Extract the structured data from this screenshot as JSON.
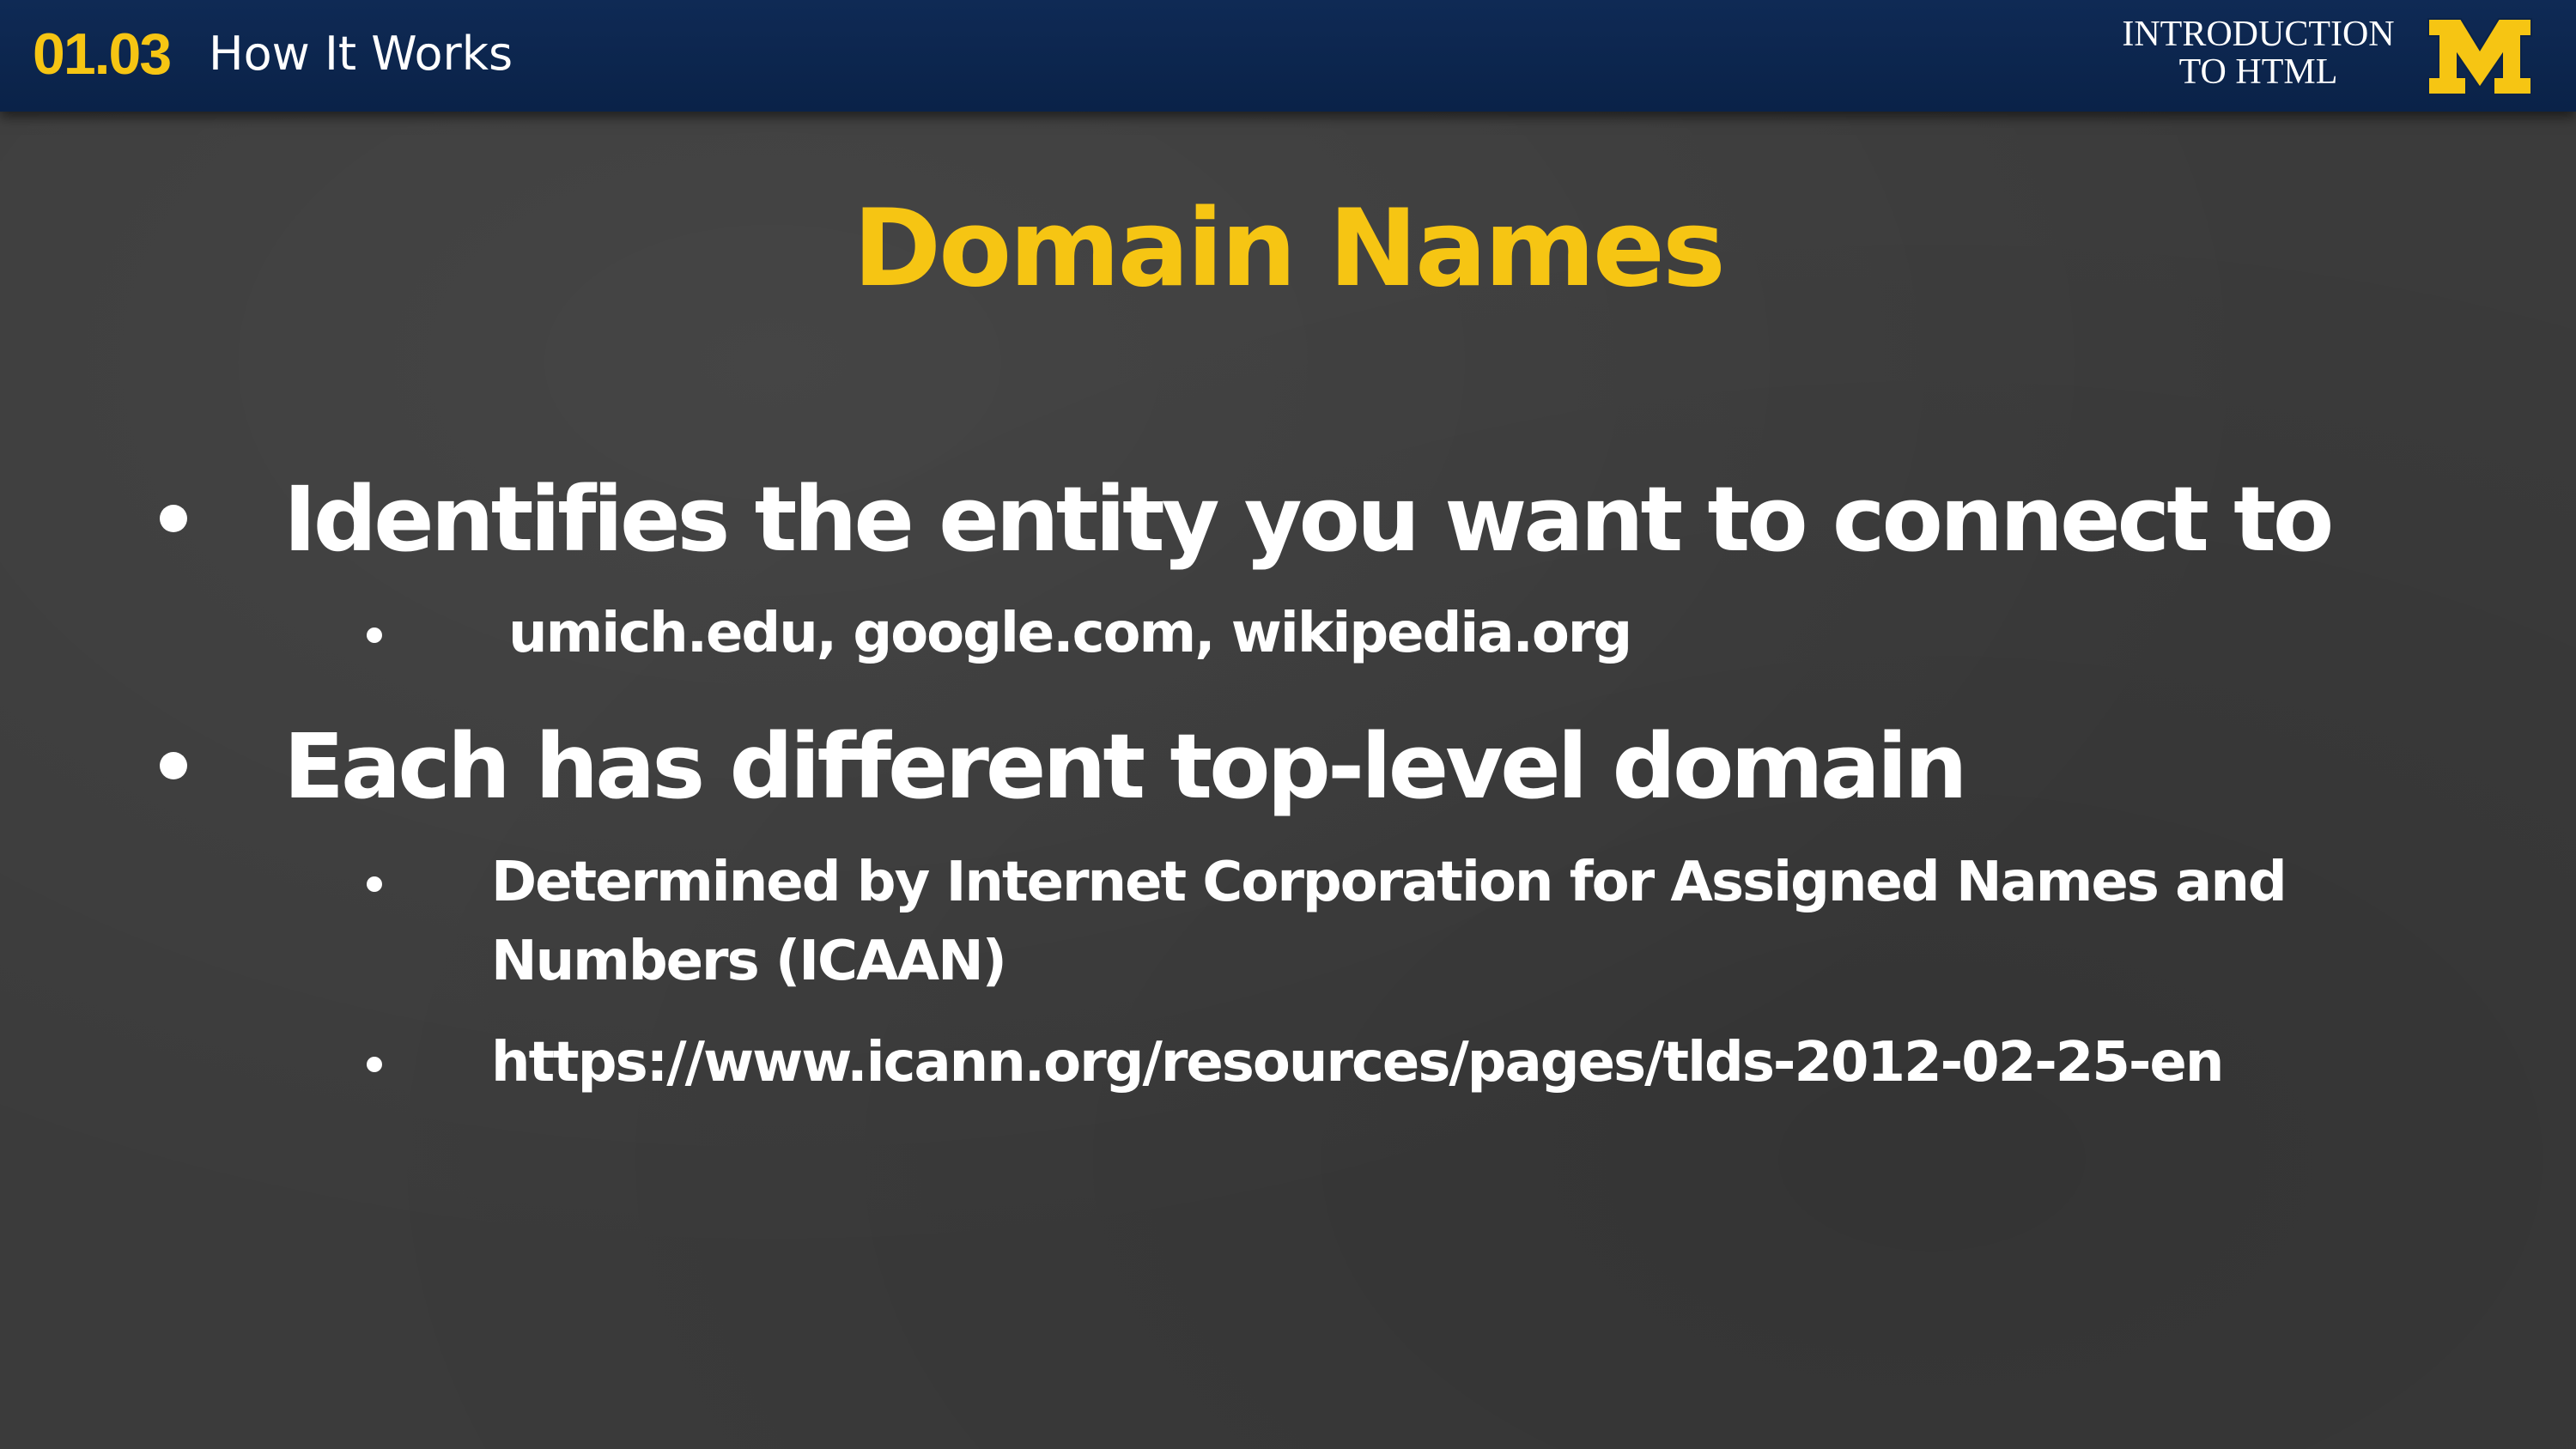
{
  "header": {
    "lesson_number": "01.03",
    "lesson_title": "How It Works",
    "course_title_line1": "INTRODUCTION",
    "course_title_line2": "TO HTML",
    "logo_letter": "M",
    "logo_icon": "michigan-block-m-logo"
  },
  "slide": {
    "title": "Domain Names",
    "bullets": [
      {
        "text": "Identifies the entity you want to connect to",
        "sub": [
          "umich.edu, google.com, wikipedia.org"
        ]
      },
      {
        "text": "Each has different top-level domain",
        "sub": [
          "Determined by Internet Corporation for Assigned Names and Numbers (ICAAN)",
          "https://www.icann.org/resources/pages/tlds-2012-02-25-en"
        ]
      }
    ]
  },
  "colors": {
    "header_bg": "#0a2248",
    "accent_maize": "#f6c513",
    "background": "#3b3b3b",
    "text": "#ffffff"
  }
}
